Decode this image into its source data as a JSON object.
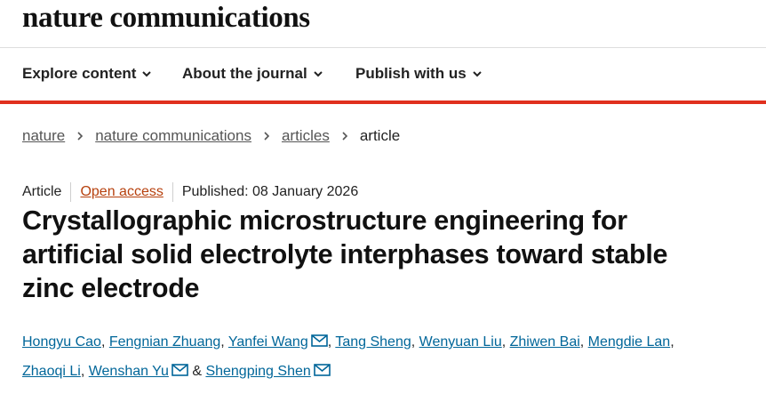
{
  "site": {
    "logo": "nature communications"
  },
  "nav": {
    "items": [
      {
        "label": "Explore content"
      },
      {
        "label": "About the journal"
      },
      {
        "label": "Publish with us"
      }
    ]
  },
  "breadcrumb": {
    "items": [
      "nature",
      "nature communications",
      "articles"
    ],
    "current": "article"
  },
  "meta": {
    "type": "Article",
    "access": "Open access",
    "published": "Published: 08 January 2026"
  },
  "title": {
    "lines": [
      "Crystallographic microstructure engineering for",
      "artificial solid electrolyte interphases toward stable",
      "zinc electrode"
    ]
  },
  "authors": {
    "names": [
      "Hongyu Cao",
      "Fengnian Zhuang",
      "Yanfei Wang",
      "Tang Sheng",
      "Wenyuan Liu",
      "Zhiwen Bai",
      "Mengdie Lan",
      "Zhaoqi Li",
      "Wenshan Yu",
      "Shengping Shen"
    ],
    "separator": ", ",
    "last_separator": " & "
  },
  "colors": {
    "accent_red": "#e0301e",
    "link_blue": "#006699",
    "open_access": "#b7410e"
  },
  "icons": [
    "chevron-down-icon",
    "chevron-right-icon",
    "mail-icon"
  ]
}
